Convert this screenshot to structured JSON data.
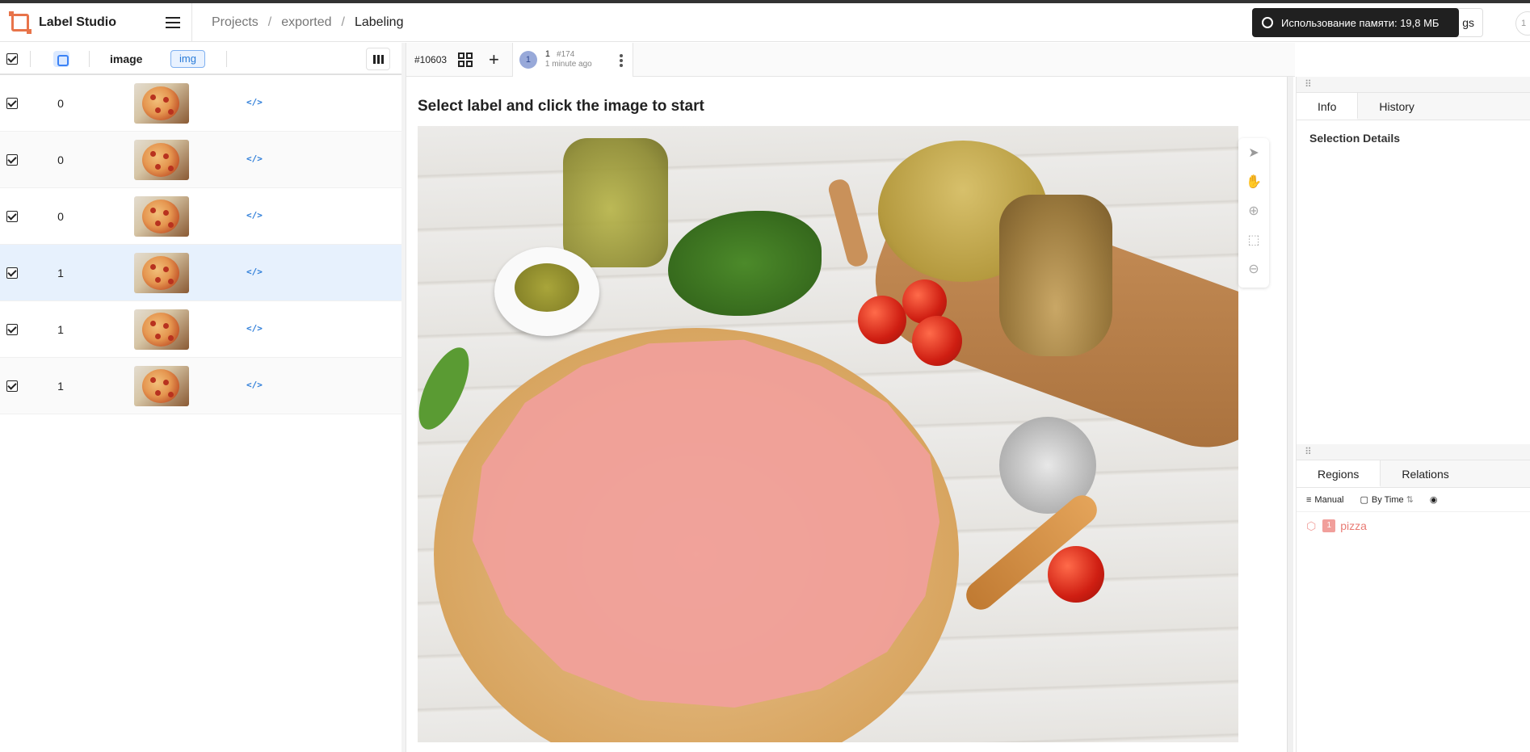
{
  "app": {
    "name": "Label Studio"
  },
  "breadcrumbs": [
    "Projects",
    "exported",
    "Labeling"
  ],
  "toast": {
    "text": "Использование памяти: 19,8 МБ"
  },
  "header": {
    "settings_label": "gs",
    "user_badge": "1"
  },
  "table": {
    "columns": {
      "image": "image",
      "img_tag": "img"
    },
    "rows": [
      {
        "num": "0",
        "code": "</>"
      },
      {
        "num": "0",
        "code": "</>"
      },
      {
        "num": "0",
        "code": "</>"
      },
      {
        "num": "1",
        "code": "</>"
      },
      {
        "num": "1",
        "code": "</>"
      },
      {
        "num": "1",
        "code": "</>"
      }
    ]
  },
  "editor": {
    "task_id": "#10603",
    "annotation": {
      "avatar": "1",
      "id": "1",
      "hash": "#174",
      "time": "1 minute ago"
    },
    "hint": "Select label and click the image to start"
  },
  "right": {
    "tabs": [
      "Info",
      "History"
    ],
    "selection_title": "Selection Details",
    "region_tabs": [
      "Regions",
      "Relations"
    ],
    "region_tools": {
      "manual": "Manual",
      "by_time": "By Time"
    },
    "regions": [
      {
        "num": "1",
        "label": "pizza",
        "color": "#f19f9b"
      }
    ]
  }
}
